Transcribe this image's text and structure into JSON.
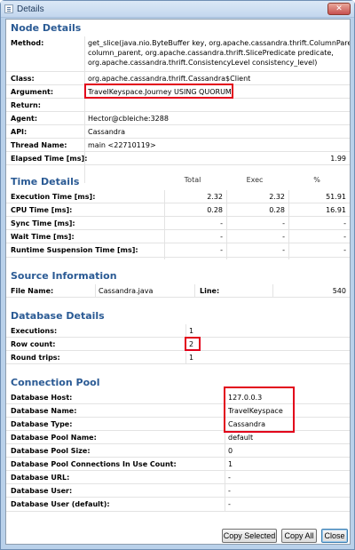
{
  "window": {
    "title": "Details",
    "close_glyph": "✕"
  },
  "node_details": {
    "title": "Node Details",
    "rows": [
      {
        "label": "Method:",
        "lines": [
          "get_slice(java.nio.ByteBuffer key, org.apache.cassandra.thrift.ColumnParent",
          "column_parent, org.apache.cassandra.thrift.SlicePredicate predicate,",
          "org.apache.cassandra.thrift.ConsistencyLevel consistency_level)"
        ]
      },
      {
        "label": "Class:",
        "value": "org.apache.cassandra.thrift.Cassandra$Client"
      },
      {
        "label": "Argument:",
        "value": "TravelKeyspace.Journey USING QUORUM"
      },
      {
        "label": "Return:",
        "value": ""
      },
      {
        "label": "Agent:",
        "value": "Hector@cbleiche:3288"
      },
      {
        "label": "API:",
        "value": "Cassandra"
      },
      {
        "label": "Thread Name:",
        "value": "main <22710119>"
      },
      {
        "label": "Elapsed Time [ms]:",
        "value": "1.99"
      }
    ]
  },
  "time_details": {
    "title": "Time Details",
    "headers": [
      "Total",
      "Exec",
      "%"
    ],
    "rows": [
      {
        "label": "Execution Time [ms]:",
        "values": [
          "2.32",
          "2.32",
          "51.91"
        ]
      },
      {
        "label": "CPU Time [ms]:",
        "values": [
          "0.28",
          "0.28",
          "16.91"
        ]
      },
      {
        "label": "Sync Time [ms]:",
        "values": [
          "-",
          "-",
          "-"
        ]
      },
      {
        "label": "Wait Time [ms]:",
        "values": [
          "-",
          "-",
          "-"
        ]
      },
      {
        "label": "Runtime Suspension Time [ms]:",
        "values": [
          "-",
          "-",
          "-"
        ]
      }
    ]
  },
  "source_information": {
    "title": "Source Information",
    "file_label": "File Name:",
    "file_value": "Cassandra.java",
    "line_label": "Line:",
    "line_value": "540"
  },
  "database_details": {
    "title": "Database Details",
    "rows": [
      {
        "label": "Executions:",
        "value": "1"
      },
      {
        "label": "Row count:",
        "value": "2"
      },
      {
        "label": "Round trips:",
        "value": "1"
      }
    ]
  },
  "connection_pool": {
    "title": "Connection Pool",
    "rows": [
      {
        "label": "Database Host:",
        "value": "127.0.0.3"
      },
      {
        "label": "Database Name:",
        "value": "TravelKeyspace"
      },
      {
        "label": "Database Type:",
        "value": "Cassandra"
      },
      {
        "label": "Database Pool Name:",
        "value": "default"
      },
      {
        "label": "Database Pool Size:",
        "value": "0"
      },
      {
        "label": "Database Pool Connections In Use Count:",
        "value": "1"
      },
      {
        "label": "Database URL:",
        "value": "-"
      },
      {
        "label": "Database User:",
        "value": "-"
      },
      {
        "label": "Database User (default):",
        "value": "-"
      }
    ]
  },
  "buttons": {
    "copy_selected": "Copy Selected",
    "copy_all": "Copy All",
    "close": "Close"
  },
  "colors": {
    "section_title": "#2a5a94",
    "highlight": "#e2001a",
    "titlebar": "#c3d7ee"
  }
}
